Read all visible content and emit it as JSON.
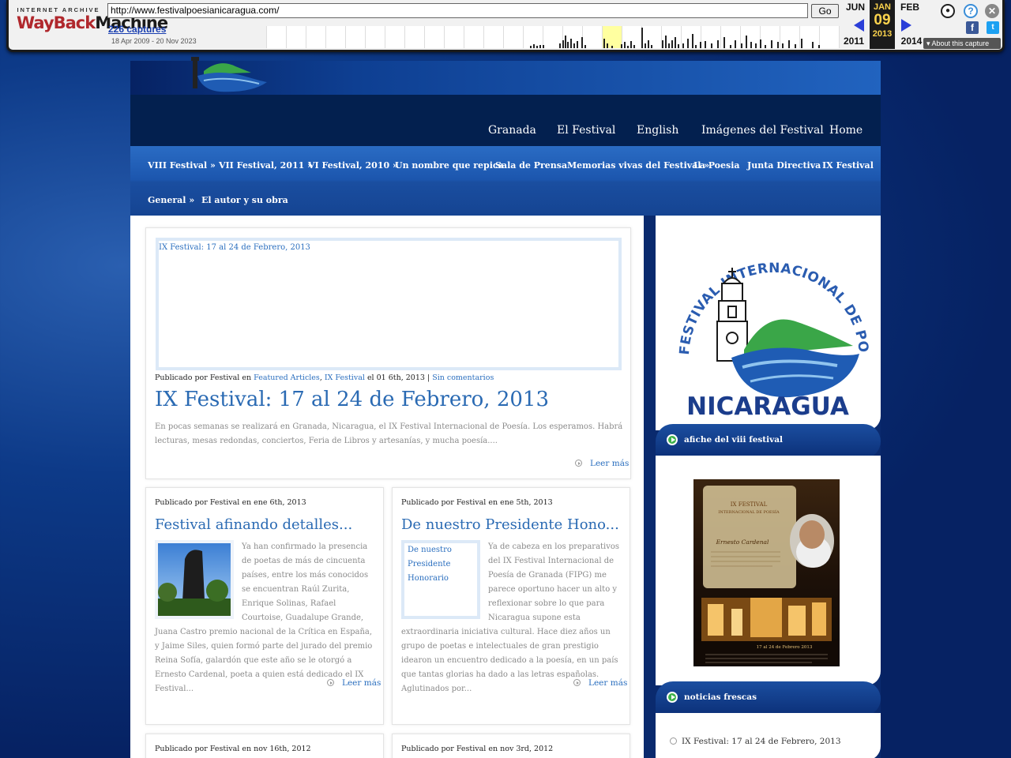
{
  "wayback": {
    "logo_top": "INTERNET ARCHIVE",
    "logo_main": "WayBack",
    "logo_main2": "Machine",
    "url": "http://www.festivalpoesianicaragua.com/",
    "go_label": "Go",
    "captures": "226 captures",
    "date_range": "18 Apr 2009 - 20 Nov 2023",
    "prev_month": "JUN",
    "prev_year": "2011",
    "cur_month": "JAN",
    "cur_day": "09",
    "cur_year": "2013",
    "next_month": "FEB",
    "next_year": "2014",
    "about": "About this capture"
  },
  "nav_top": [
    {
      "label": "Granada"
    },
    {
      "label": "El Festival"
    },
    {
      "label": "English"
    },
    {
      "label": "Imágenes del Festival"
    },
    {
      "label": "Home"
    }
  ],
  "nav_sub": [
    {
      "label": "VIII Festival »"
    },
    {
      "label": "VII Festival, 2011 »"
    },
    {
      "label": "VI Festival, 2010 »"
    },
    {
      "label": "Un nombre que repica"
    },
    {
      "label": "Sala de Prensa"
    },
    {
      "label": "Memorias vivas del Festival »"
    },
    {
      "label": "La Poesia"
    },
    {
      "label": "Junta Directiva"
    },
    {
      "label": "IX Festival"
    },
    {
      "label": "General »"
    },
    {
      "label": "El autor y su obra"
    }
  ],
  "featured": {
    "image_alt": "IX Festival: 17 al 24 de Febrero, 2013",
    "meta_prefix": "Publicado por Festival en",
    "cat1": "Featured Articles",
    "sep": ",",
    "cat2": "IX Festival",
    "meta_date": "el 01 6th, 2013 |",
    "comments": "Sin comentarios",
    "title": "IX Festival: 17 al 24 de Febrero, 2013",
    "excerpt": "En pocas semanas se realizará en Granada, Nicaragua, el IX Festival Internacional de Poesía. Los esperamos. Habrá lecturas, mesas redondas, conciertos, Feria de Libros y artesanías, y mucha poesía....",
    "more": "Leer más"
  },
  "posts": [
    {
      "meta": "Publicado por Festival en ene 6th, 2013",
      "title": "Festival afinando detalles...",
      "excerpt": "Ya han confirmado la presencia de poetas de más de cincuenta países, entre los más conocidos se encuentran Raúl Zurita, Enrique Solinas, Rafael Courtoise, Guadalupe Grande, Juana Castro premio nacional de la Crítica en España, y Jaime Siles, quien formó parte del jurado del premio Reina Sofía, galardón que este año se le otorgó a Ernesto Cardenal, poeta a quien está dedicado el IX Festival...",
      "more": "Leer más"
    },
    {
      "meta": "Publicado por Festival en ene 5th, 2013",
      "title": "De nuestro Presidente Hono...",
      "image_alt": "De nuestro Presidente Honorario",
      "excerpt": "Ya de cabeza en los preparativos del IX Festival Internacional de Poesía de Granada (FIPG) me parece oportuno hacer un alto y reflexionar sobre lo que para Nicaragua supone esta extraordinaria iniciativa cultural. Hace diez años un grupo de poetas e intelectuales de gran prestigio idearon un encuentro dedicado a la poesía, en un país que tantas glorias ha dado a las letras españolas. Aglutinados por...",
      "more": "Leer más"
    },
    {
      "meta": "Publicado por Festival en nov 16th, 2012"
    },
    {
      "meta": "Publicado por Festival en nov 3rd, 2012"
    }
  ],
  "sidebar": {
    "logo_arc": "FESTIVAL INTERNACIONAL DE POESIA DE GRANADA",
    "logo_country": "NICARAGUA",
    "widget1_title": "afiche del viii festival",
    "poster": {
      "line1": "IX FESTIVAL",
      "line2": "INTERNACIONAL DE POESÍA",
      "line3": "Ernesto Cardenal",
      "dates": "17 al 24 de Febrero 2013"
    },
    "widget2_title": "noticias frescas",
    "news": [
      "IX Festival: 17 al 24 de Febrero, 2013"
    ]
  }
}
